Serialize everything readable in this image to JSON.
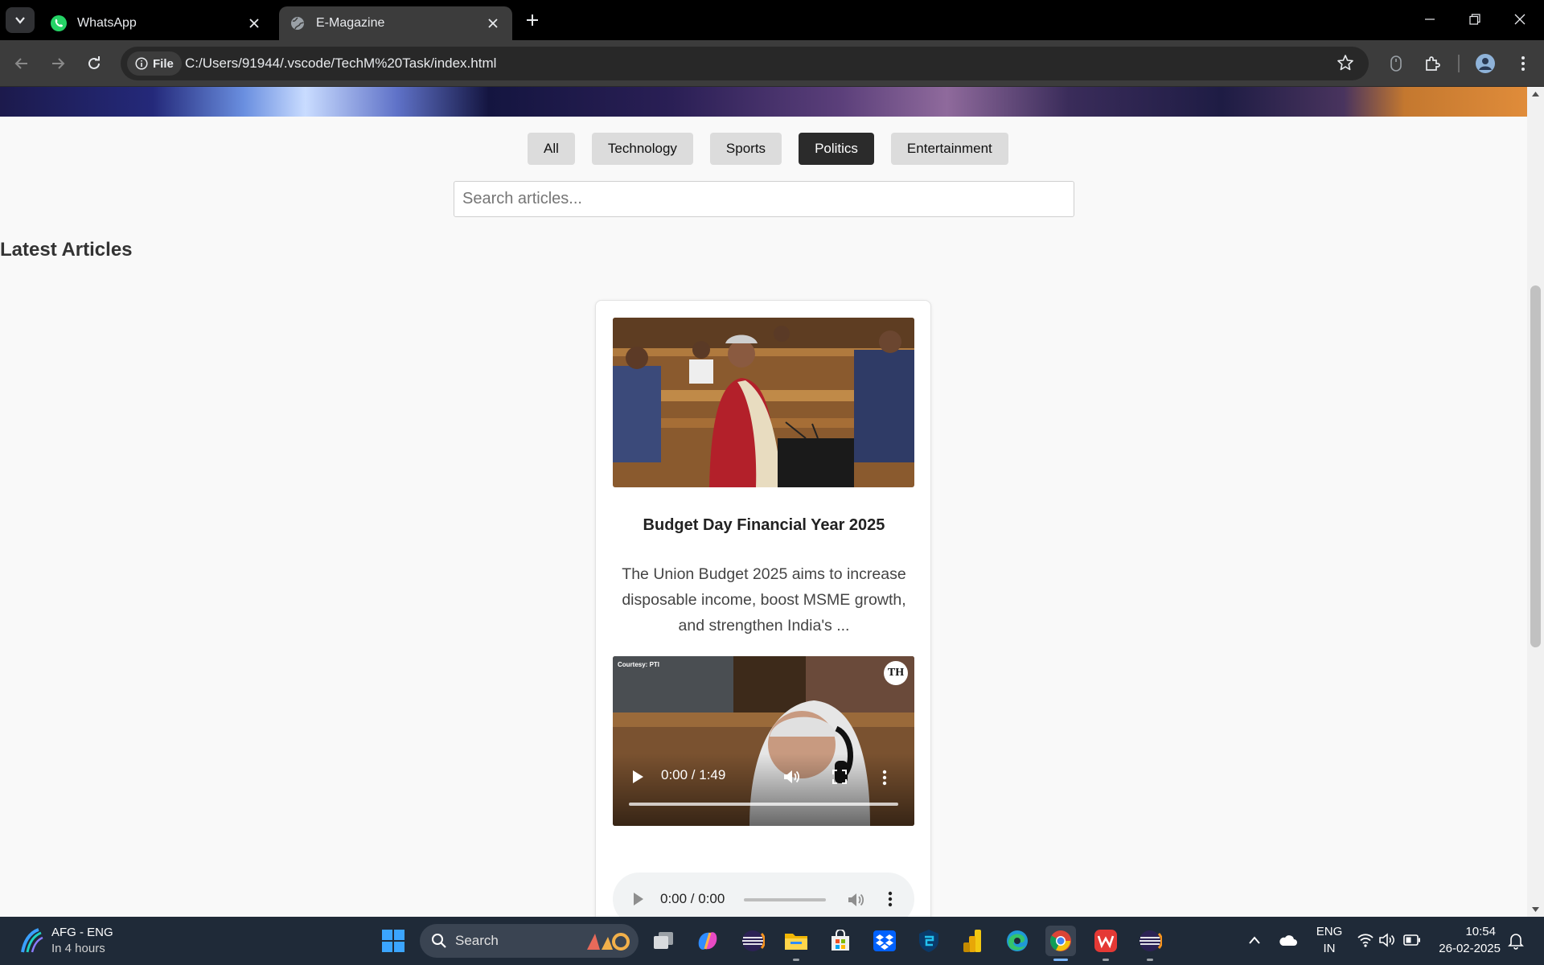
{
  "browser": {
    "tabs": [
      {
        "title": "WhatsApp",
        "active": false
      },
      {
        "title": "E-Magazine",
        "active": true
      }
    ],
    "address": {
      "chip_label": "File",
      "url": "C:/Users/91944/.vscode/TechM%20Task/index.html"
    }
  },
  "page": {
    "filters": [
      {
        "label": "All",
        "active": false
      },
      {
        "label": "Technology",
        "active": false
      },
      {
        "label": "Sports",
        "active": false
      },
      {
        "label": "Politics",
        "active": true
      },
      {
        "label": "Entertainment",
        "active": false
      }
    ],
    "search_placeholder": "Search articles...",
    "section_title": "Latest Articles",
    "article": {
      "title": "Budget Day Financial Year 2025",
      "excerpt": "The Union Budget 2025 aims to increase disposable income, boost MSME growth, and strengthen India's ...",
      "video": {
        "time": "0:00 / 1:49",
        "courtesy": "Courtesy: PTI",
        "logo": "TH"
      },
      "audio": {
        "time": "0:00 / 0:00"
      }
    }
  },
  "taskbar": {
    "weather": {
      "title": "AFG - ENG",
      "subtitle": "In 4 hours"
    },
    "search_label": "Search",
    "language": {
      "line1": "ENG",
      "line2": "IN"
    },
    "clock": {
      "time": "10:54",
      "date": "26-02-2025"
    }
  },
  "colors": {
    "active_filter": "#2b2b2b",
    "filter": "#dcdcdc",
    "taskbar": "#1f2a38"
  }
}
